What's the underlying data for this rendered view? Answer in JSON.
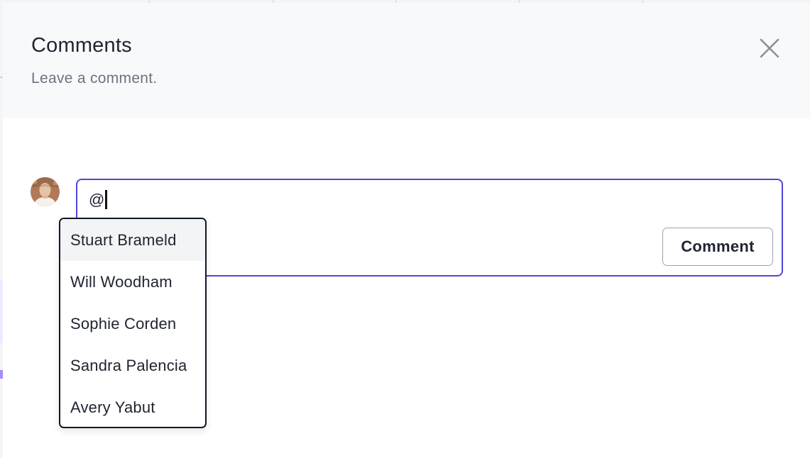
{
  "drawer": {
    "title": "Comments",
    "subtitle": "Leave a comment."
  },
  "icons": {
    "close": "close-icon",
    "avatar": "user-avatar"
  },
  "comment_input": {
    "value": "@"
  },
  "actions": {
    "comment_label": "Comment"
  },
  "mention_menu": {
    "items": [
      {
        "label": "Stuart Brameld",
        "highlighted": true
      },
      {
        "label": "Will Woodham",
        "highlighted": false
      },
      {
        "label": "Sophie Corden",
        "highlighted": false
      },
      {
        "label": "Sandra Palencia",
        "highlighted": false
      },
      {
        "label": "Avery Yabut",
        "highlighted": false
      }
    ]
  },
  "colors": {
    "accent": "#5046d6",
    "header_bg": "#f8f9fb",
    "text": "#1f2430",
    "muted": "#6b7280"
  }
}
